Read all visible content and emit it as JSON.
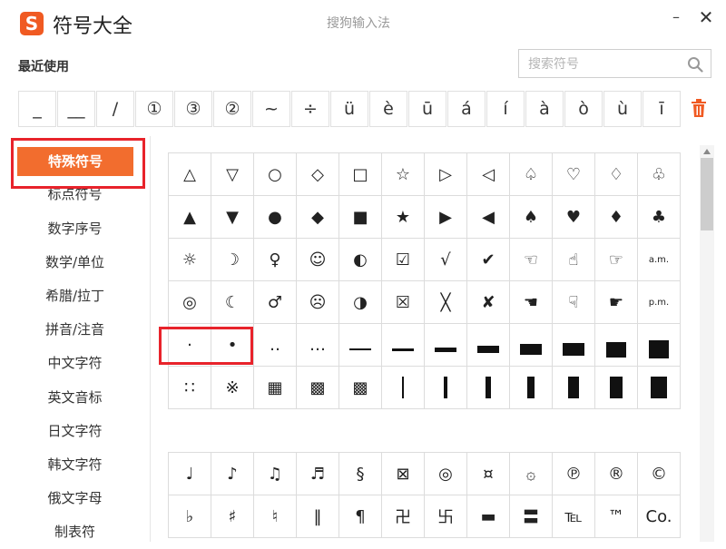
{
  "app": {
    "logo_letter": "S",
    "title": "符号大全",
    "window_title": "搜狗输入法",
    "minimize": "–",
    "close": "✕"
  },
  "recent": {
    "label": "最近使用",
    "symbols": [
      "_",
      "__",
      "/",
      "①",
      "③",
      "②",
      "~",
      "÷",
      "ü",
      "è",
      "ū",
      "á",
      "í",
      "à",
      "ò",
      "ù",
      "ī"
    ]
  },
  "search": {
    "placeholder": "搜索符号",
    "value": ""
  },
  "sidebar": {
    "items": [
      {
        "label": "特殊符号",
        "active": true
      },
      {
        "label": "标点符号",
        "active": false
      },
      {
        "label": "数字序号",
        "active": false
      },
      {
        "label": "数学/单位",
        "active": false
      },
      {
        "label": "希腊/拉丁",
        "active": false
      },
      {
        "label": "拼音/注音",
        "active": false
      },
      {
        "label": "中文字符",
        "active": false
      },
      {
        "label": "英文音标",
        "active": false
      },
      {
        "label": "日文字符",
        "active": false
      },
      {
        "label": "韩文字符",
        "active": false
      },
      {
        "label": "俄文字母",
        "active": false
      },
      {
        "label": "制表符",
        "active": false
      }
    ]
  },
  "grid": {
    "rows": [
      [
        "△",
        "▽",
        "○",
        "◇",
        "□",
        "☆",
        "▷",
        "◁",
        "♤",
        "♡",
        "♢",
        "♧"
      ],
      [
        "▲",
        "▼",
        "●",
        "◆",
        "■",
        "★",
        "▶",
        "◀",
        "♠",
        "♥",
        "♦",
        "♣"
      ],
      [
        "☼",
        "☽",
        "♀",
        "☺",
        "◐",
        "☑",
        "√",
        "✔",
        "☜",
        "☝",
        "☞",
        "a.m."
      ],
      [
        "◎",
        "☾",
        "♂",
        "☹",
        "◑",
        "☒",
        "╳",
        "✘",
        "☚",
        "☟",
        "☛",
        "p.m."
      ],
      [
        "·",
        "•",
        "‥",
        "…",
        "",
        "",
        "",
        "",
        "",
        "",
        "",
        ""
      ],
      [
        "∷",
        "※",
        "▦",
        "▩",
        "▩",
        "",
        "",
        "",
        "",
        "",
        "",
        ""
      ]
    ]
  },
  "grid2": {
    "rows": [
      [
        "♩",
        "♪",
        "♫",
        "♬",
        "§",
        "⊠",
        "◎",
        "¤",
        "۞",
        "℗",
        "®",
        "©"
      ],
      [
        "♭",
        "♯",
        "♮",
        "‖",
        "¶",
        "卍",
        "卐",
        "▬",
        "〓",
        "℡",
        "™",
        "Co."
      ]
    ]
  },
  "colors": {
    "accent": "#f26d2e",
    "highlight": "#e8232b",
    "logo": "#f05a22"
  }
}
